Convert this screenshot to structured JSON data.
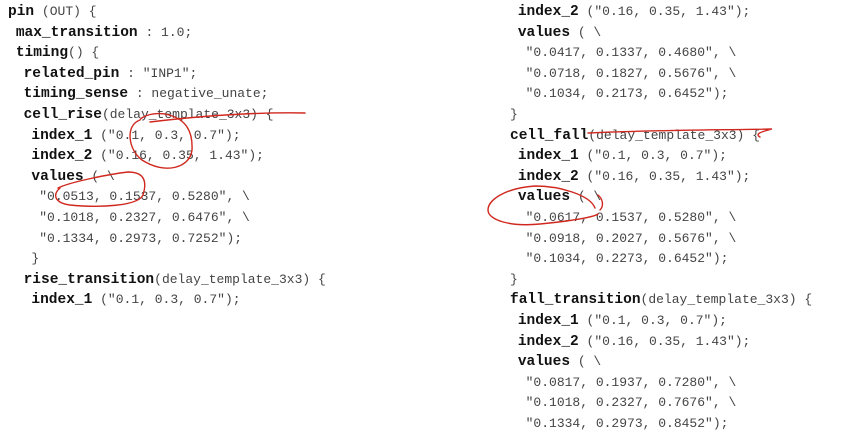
{
  "left": [
    {
      "kw": "pin",
      "rest": " (OUT) {"
    },
    {
      "indent": " ",
      "kw": "max_transition",
      "rest": " : 1.0;"
    },
    {
      "indent": " ",
      "kw": "timing",
      "rest": "() {"
    },
    {
      "indent": "  ",
      "kw": "related_pin",
      "rest": " : \"INP1\";"
    },
    {
      "indent": "  ",
      "kw": "timing_sense",
      "rest": " : negative_unate;"
    },
    {
      "indent": "  ",
      "kw": "cell_rise",
      "rest": "(delay_template_3x3) {"
    },
    {
      "indent": "   ",
      "kw": "index_1",
      "rest": " (\"0.1, 0.3, 0.7\");"
    },
    {
      "indent": "   ",
      "kw": "index_2",
      "rest": " (\"0.16, 0.35, 1.43\");"
    },
    {
      "indent": "   ",
      "kw": "values",
      "rest": " ( \\"
    },
    {
      "indent": "    ",
      "rest": "\"0.0513, 0.1537, 0.5280\", \\"
    },
    {
      "indent": "    ",
      "rest": "\"0.1018, 0.2327, 0.6476\", \\"
    },
    {
      "indent": "    ",
      "rest": "\"0.1334, 0.2973, 0.7252\");"
    },
    {
      "indent": "   ",
      "rest": "}"
    },
    {
      "indent": "  ",
      "kw": "rise_transition",
      "rest": "(delay_template_3x3) {"
    },
    {
      "indent": "   ",
      "kw": "index_1",
      "rest": " (\"0.1, 0.3, 0.7\");"
    }
  ],
  "right": [
    {
      "indent": " ",
      "kw": "index_2",
      "rest": " (\"0.16, 0.35, 1.43\");"
    },
    {
      "indent": " ",
      "kw": "values",
      "rest": " ( \\"
    },
    {
      "indent": "  ",
      "rest": "\"0.0417, 0.1337, 0.4680\", \\"
    },
    {
      "indent": "  ",
      "rest": "\"0.0718, 0.1827, 0.5676\", \\"
    },
    {
      "indent": "  ",
      "rest": "\"0.1034, 0.2173, 0.6452\");"
    },
    {
      "rest": "}"
    },
    {
      "kw": "cell_fall",
      "rest": "(delay_template_3x3) {"
    },
    {
      "indent": " ",
      "kw": "index_1",
      "rest": " (\"0.1, 0.3, 0.7\");"
    },
    {
      "indent": " ",
      "kw": "index_2",
      "rest": " (\"0.16, 0.35, 1.43\");"
    },
    {
      "indent": " ",
      "kw": "values",
      "rest": " ( \\"
    },
    {
      "indent": "  ",
      "rest": "\"0.0617, 0.1537, 0.5280\", \\"
    },
    {
      "indent": "  ",
      "rest": "\"0.0918, 0.2027, 0.5676\", \\"
    },
    {
      "indent": "  ",
      "rest": "\"0.1034, 0.2273, 0.6452\");"
    },
    {
      "rest": "}"
    },
    {
      "kw": "fall_transition",
      "rest": "(delay_template_3x3) {"
    },
    {
      "indent": " ",
      "kw": "index_1",
      "rest": " (\"0.1, 0.3, 0.7\");"
    },
    {
      "indent": " ",
      "kw": "index_2",
      "rest": " (\"0.16, 0.35, 1.43\");"
    },
    {
      "indent": " ",
      "kw": "values",
      "rest": " ( \\"
    },
    {
      "indent": "  ",
      "rest": "\"0.0817, 0.1937, 0.7280\", \\"
    },
    {
      "indent": "  ",
      "rest": "\"0.1018, 0.2327, 0.7676\", \\"
    },
    {
      "indent": "  ",
      "rest": "\"0.1334, 0.2973, 0.8452\");"
    }
  ],
  "annotation_color": "#d0281e"
}
